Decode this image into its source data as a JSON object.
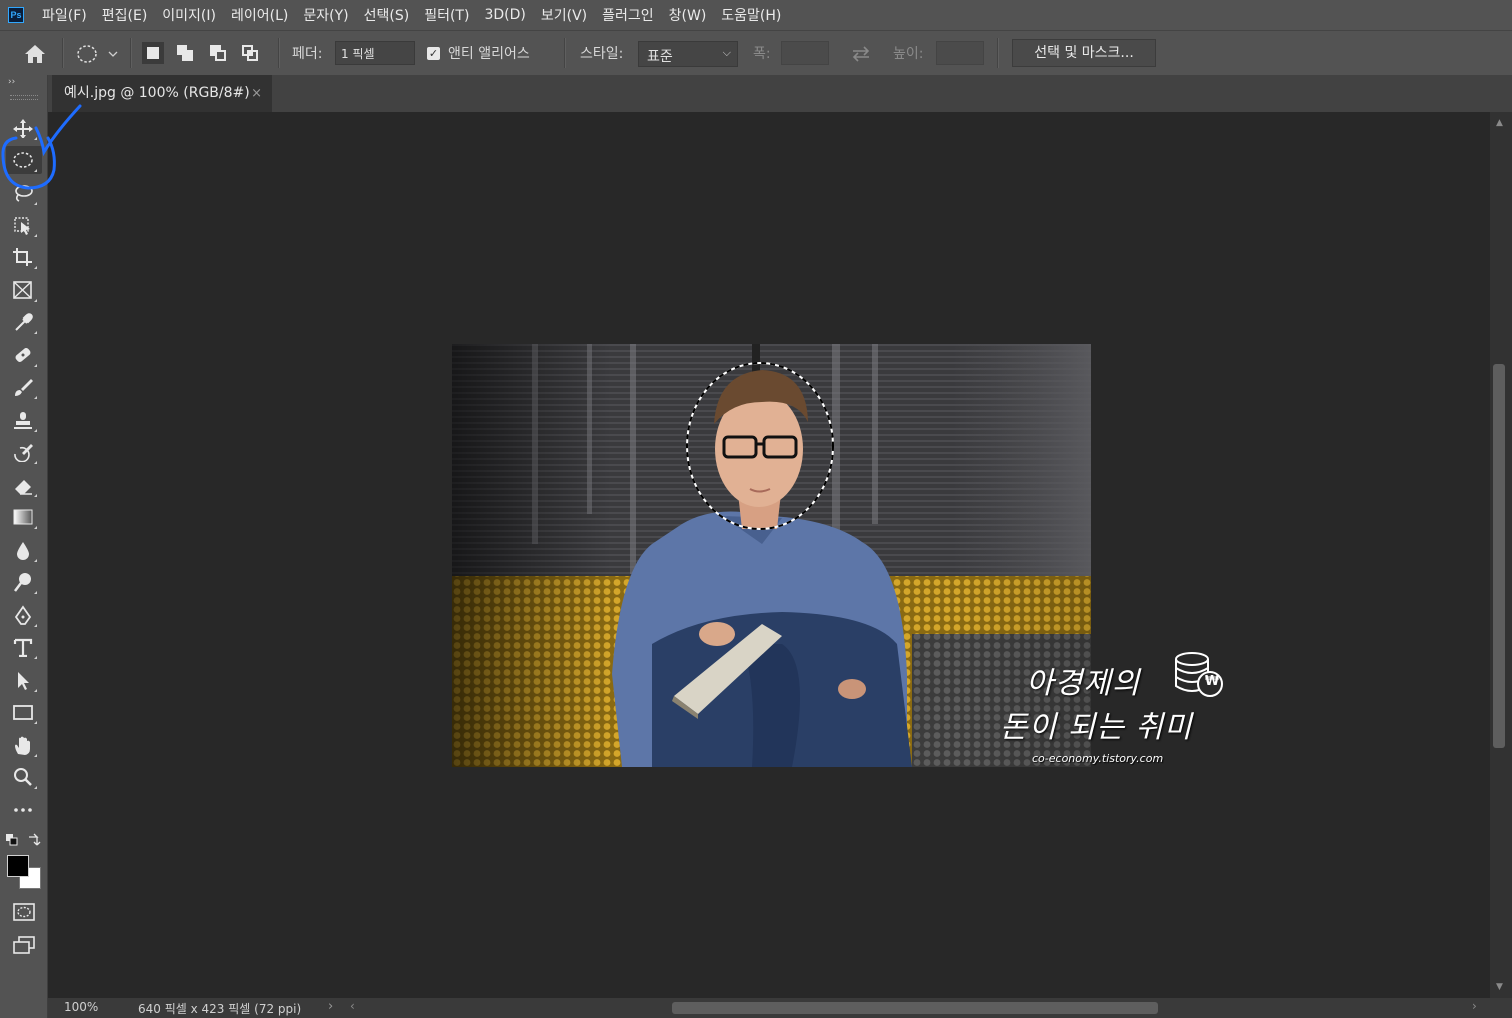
{
  "app": {
    "logo": "Ps"
  },
  "menu": [
    "파일(F)",
    "편집(E)",
    "이미지(I)",
    "레이어(L)",
    "문자(Y)",
    "선택(S)",
    "필터(T)",
    "3D(D)",
    "보기(V)",
    "플러그인",
    "창(W)",
    "도움말(H)"
  ],
  "options": {
    "feather_label": "페더:",
    "feather_value": "1 픽셀",
    "antialias_label": "앤티 앨리어스",
    "antialias_checked": true,
    "style_label": "스타일:",
    "style_value": "표준",
    "width_label": "폭:",
    "height_label": "높이:",
    "mask_button": "선택 및 마스크..."
  },
  "document": {
    "tab_title": "예시.jpg @ 100% (RGB/8#)",
    "close": "×"
  },
  "watermark": {
    "line1": "아경제의",
    "line2": "돈이 되는 취미",
    "url": "co-economy.tistory.com",
    "coin_symbol": "₩"
  },
  "status": {
    "zoom": "100%",
    "info": "640 픽셀 x 423 픽셀 (72 ppi)",
    "more": "›"
  },
  "tools": {
    "active": "elliptical-marquee-tool",
    "icons": [
      "move-icon",
      "elliptical-marquee-icon",
      "lasso-icon",
      "object-selection-icon",
      "crop-icon",
      "frame-icon",
      "eyedropper-icon",
      "healing-brush-icon",
      "brush-icon",
      "clone-stamp-icon",
      "history-brush-icon",
      "eraser-icon",
      "gradient-icon",
      "blur-icon",
      "dodge-icon",
      "pen-icon",
      "type-icon",
      "path-selection-icon",
      "rectangle-icon",
      "hand-icon",
      "zoom-icon",
      "more-icon"
    ]
  },
  "colors": {
    "foreground": "#000000",
    "background": "#ffffff",
    "annotation": "#1e6cff"
  }
}
